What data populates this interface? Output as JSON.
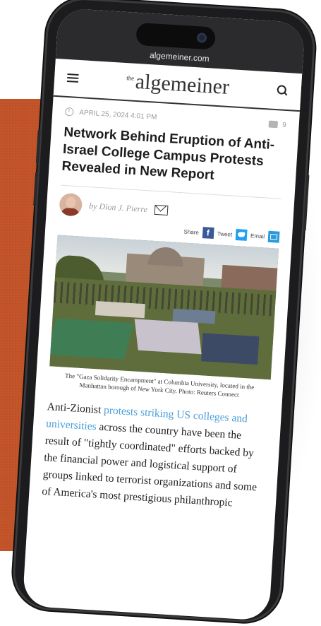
{
  "browser": {
    "url": "algemeiner.com"
  },
  "site": {
    "logo_prefix": "the",
    "logo": "algemeiner"
  },
  "article": {
    "date": "APRIL 25, 2024 4:01 PM",
    "comment_count": "9",
    "title": "Network Behind Eruption of Anti-Israel College Campus Protests Revealed in New Report",
    "author": "by Dion J. Pierre",
    "share_label": "Share",
    "tweet_label": "Tweet",
    "email_label": "Email",
    "facebook_glyph": "f",
    "photo_caption": "The \"Gaza Solidarity Encampment\" at Columbia University, located in the Manhattan borough of New York City. Photo: Reuters Connect",
    "body_start": "Anti-Zionist ",
    "body_link": "protests striking US colleges and universities",
    "body_rest": " across the country have been the result of \"tightly coordinated\" efforts backed by the financial power and logistical support of groups linked to terrorist organizations and some of America's most prestigious philanthropic"
  },
  "colors": {
    "accent_orange": "#c4552a",
    "link": "#4a9fd8",
    "facebook": "#3b5998",
    "twitter": "#1da1f2"
  }
}
